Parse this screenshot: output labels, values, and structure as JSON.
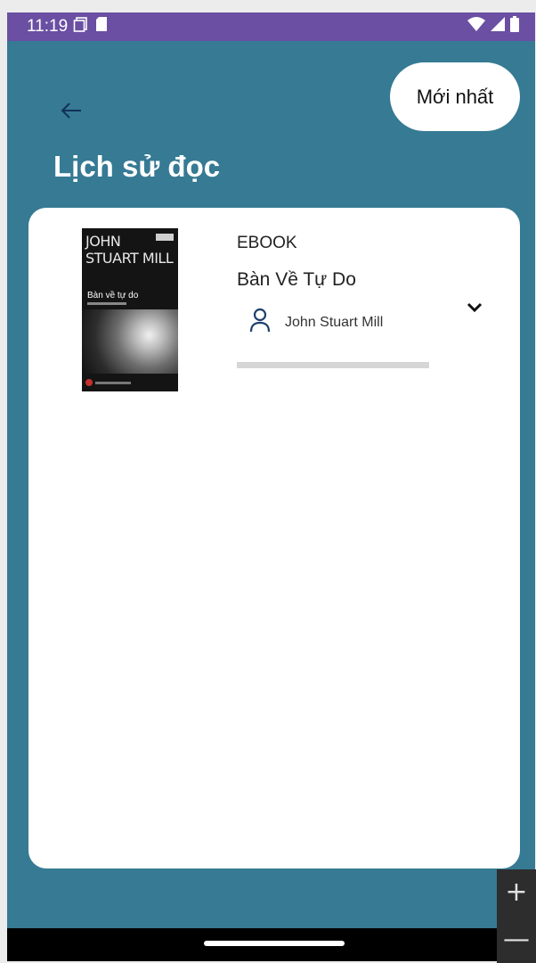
{
  "status_bar": {
    "time": "11:19",
    "icons": [
      "screen-icon",
      "sd-card-icon",
      "wifi-icon",
      "signal-icon",
      "battery-icon"
    ]
  },
  "header": {
    "back_icon": "arrow-left-icon",
    "sort_label": "Mới nhất",
    "title": "Lịch sử đọc"
  },
  "history": [
    {
      "type": "EBOOK",
      "title": "Bàn Về Tự Do",
      "author": "John Stuart Mill",
      "cover": {
        "author_line1": "JOHN",
        "author_line2": "STUART MILL",
        "title": "Bàn về tự do"
      },
      "progress": 0
    }
  ],
  "zoom": {
    "in": "+",
    "out": "—"
  },
  "colors": {
    "background": "#367a94",
    "status_bar": "#6a4fa3",
    "card": "#ffffff",
    "progress_track": "#d6d6d6"
  }
}
